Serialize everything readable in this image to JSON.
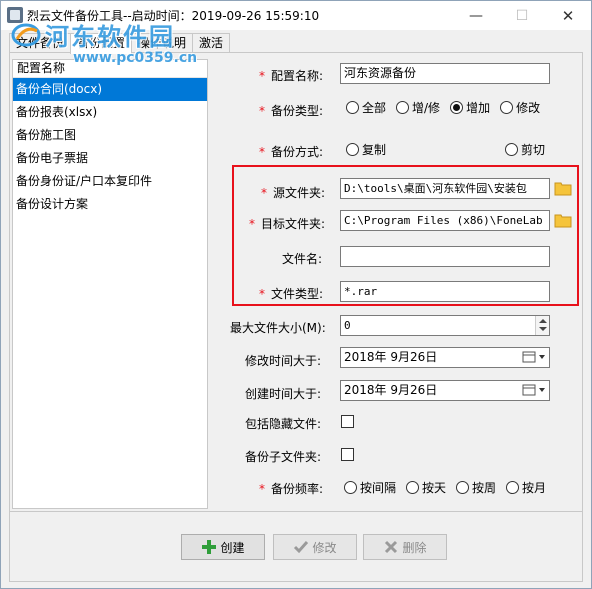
{
  "window": {
    "title": "烈云文件备份工具--启动时间：2019-09-26 15:59:10",
    "min": "—",
    "max": "☐",
    "close": "✕"
  },
  "watermark": {
    "title": "河东软件园",
    "url": "www.pc0359.cn"
  },
  "tabs": [
    {
      "label": "文件备份",
      "active": false
    },
    {
      "label": "备份配置",
      "active": true
    },
    {
      "label": "操作说明",
      "active": false
    },
    {
      "label": "激活",
      "active": false
    }
  ],
  "list": {
    "header": "配置名称",
    "items": [
      {
        "label": "备份合同(docx)",
        "selected": true
      },
      {
        "label": "备份报表(xlsx)",
        "selected": false
      },
      {
        "label": "备份施工图",
        "selected": false
      },
      {
        "label": "备份电子票据",
        "selected": false
      },
      {
        "label": "备份身份证/户口本复印件",
        "selected": false
      },
      {
        "label": "备份设计方案",
        "selected": false
      }
    ]
  },
  "form": {
    "required_mark": "*",
    "config_name": {
      "label": "配置名称:",
      "value": "河东资源备份"
    },
    "backup_type": {
      "label": "备份类型:",
      "options": [
        "全部",
        "增/修",
        "增加",
        "修改"
      ],
      "selected": "增加"
    },
    "backup_method": {
      "label": "备份方式:",
      "options": [
        "复制",
        "剪切"
      ],
      "selected": ""
    },
    "source_folder": {
      "label": "源文件夹:",
      "value": "D:\\tools\\桌面\\河东软件园\\安装包"
    },
    "target_folder": {
      "label": "目标文件夹:",
      "value": "C:\\Program Files (x86)\\FoneLab"
    },
    "file_name": {
      "label": "文件名:",
      "value": ""
    },
    "file_type": {
      "label": "文件类型:",
      "value": "*.rar"
    },
    "max_size": {
      "label": "最大文件大小(M):",
      "value": "0"
    },
    "modified_after": {
      "label": "修改时间大于:",
      "value": "2018年  9月26日"
    },
    "created_after": {
      "label": "创建时间大于:",
      "value": "2018年  9月26日"
    },
    "include_hidden": {
      "label": "包括隐藏文件:",
      "checked": false
    },
    "backup_subfolders": {
      "label": "备份子文件夹:",
      "checked": false
    },
    "frequency": {
      "label": "备份频率:",
      "options": [
        "按间隔",
        "按天",
        "按周",
        "按月"
      ],
      "selected": ""
    }
  },
  "buttons": {
    "create": "创建",
    "modify": "修改",
    "delete": "删除"
  },
  "colors": {
    "selection": "#0078d7",
    "required": "#e8111b",
    "highlight_box": "#e8111b",
    "watermark": "#3a9de0"
  }
}
